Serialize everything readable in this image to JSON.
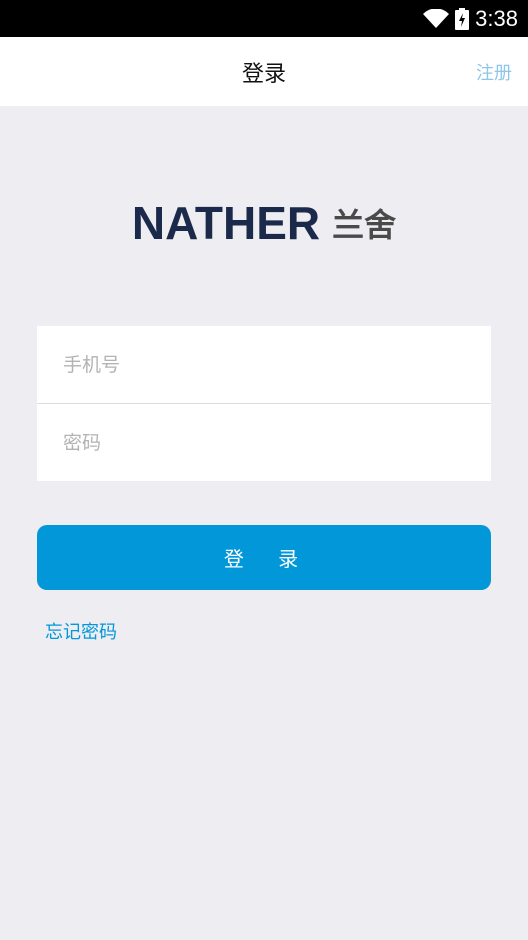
{
  "status_bar": {
    "time": "3:38",
    "icons": [
      "wifi-icon",
      "battery-charging-icon"
    ]
  },
  "navbar": {
    "title": "登录",
    "register": "注册"
  },
  "logo": {
    "brand_en": "NATHER",
    "brand_cn": "兰舍"
  },
  "form": {
    "phone_placeholder": "手机号",
    "password_placeholder": "密码"
  },
  "login_button": "登 录",
  "forgot_password": "忘记密码",
  "colors": {
    "accent": "#0197d8",
    "register_link": "#8ec6ea",
    "logo": "#1b2a4a",
    "background": "#eeedf2"
  }
}
